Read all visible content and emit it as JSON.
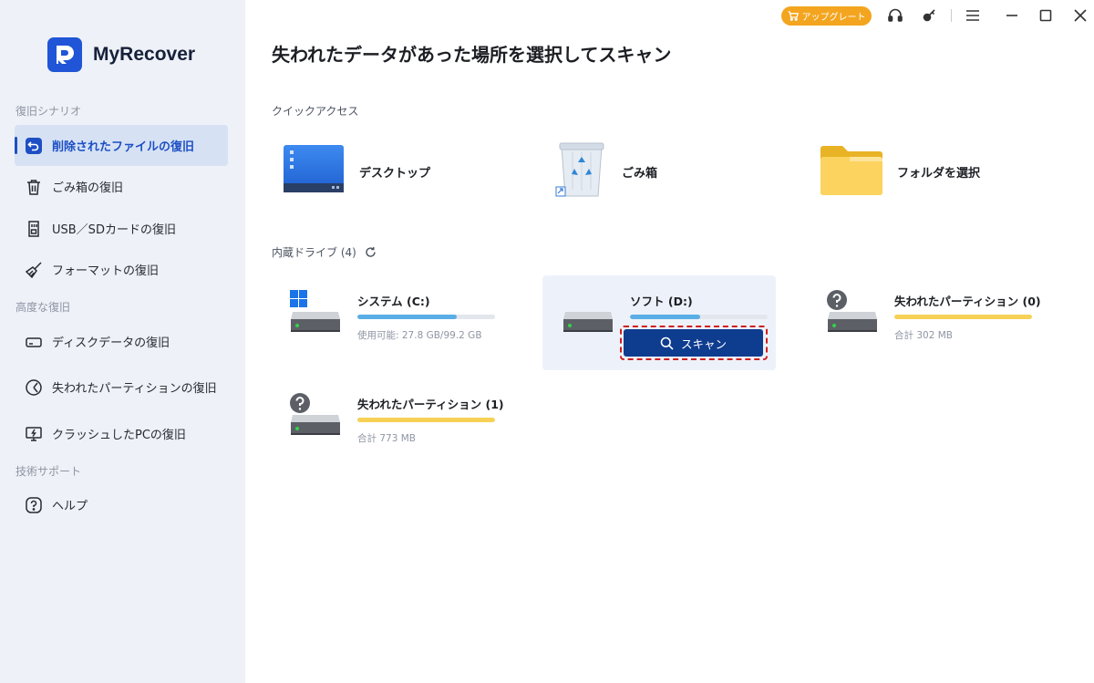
{
  "app": {
    "name": "MyRecover"
  },
  "topbar": {
    "upgrade_label": "アップグレート"
  },
  "sidebar": {
    "sections": [
      {
        "label": "復旧シナリオ"
      },
      {
        "label": "高度な復旧"
      },
      {
        "label": "技術サポート"
      }
    ],
    "items": [
      {
        "label": "削除されたファイルの復旧",
        "icon": "undo-icon",
        "active": true
      },
      {
        "label": "ごみ箱の復旧",
        "icon": "trash-icon"
      },
      {
        "label": "USB／SDカードの復旧",
        "icon": "sd-card-icon"
      },
      {
        "label": "フォーマットの復旧",
        "icon": "broom-icon"
      },
      {
        "label": "ディスクデータの復旧",
        "icon": "disk-icon"
      },
      {
        "label": "失われたパーティションの復旧",
        "icon": "partition-icon"
      },
      {
        "label": "クラッシュしたPCの復旧",
        "icon": "crashed-pc-icon"
      },
      {
        "label": "ヘルプ",
        "icon": "help-icon"
      }
    ]
  },
  "main": {
    "title": "失われたデータがあった場所を選択してスキャン",
    "quick_access": {
      "label": "クイックアクセス",
      "items": [
        {
          "label": "デスクトップ",
          "icon": "desktop-icon"
        },
        {
          "label": "ごみ箱",
          "icon": "recycle-bin-icon"
        },
        {
          "label": "フォルダを選択",
          "icon": "folder-icon"
        }
      ]
    },
    "drives": {
      "label": "内蔵ドライブ (4)",
      "items": [
        {
          "name": "システム (C:)",
          "info": "使用可能: 27.8 GB/99.2 GB",
          "fill": 0.72,
          "color": "#5aaee6",
          "icon": "windows-drive-icon"
        },
        {
          "name": "ソフト (D:)",
          "fill": 0.51,
          "color": "#5aaee6",
          "icon": "hard-drive-icon",
          "scan_label": "スキャン"
        },
        {
          "name": "失われたパーティション (0)",
          "info": "合計 302 MB",
          "fill": 1.0,
          "color": "#f7d155",
          "icon": "unknown-drive-icon"
        },
        {
          "name": "失われたパーティション (1)",
          "info": "合計 773 MB",
          "fill": 1.0,
          "color": "#f7d155",
          "icon": "unknown-drive-icon"
        }
      ]
    }
  }
}
